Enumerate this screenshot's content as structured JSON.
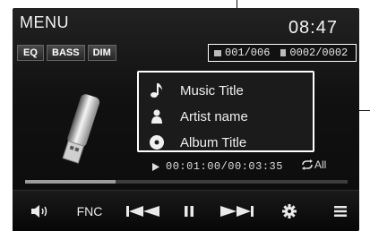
{
  "header": {
    "menu_label": "MENU",
    "clock": "08:47"
  },
  "toolbar": {
    "buttons": [
      "EQ",
      "BASS",
      "DIM"
    ]
  },
  "counter": {
    "folder": "001/006",
    "track": "0002/0002"
  },
  "track_info": {
    "title": "Music Title",
    "artist": "Artist name",
    "album": "Album Title",
    "icons": [
      "music-note-icon",
      "person-icon",
      "disc-icon"
    ]
  },
  "playback": {
    "time": "00:01:00/00:03:35",
    "repeat_label": "All",
    "progress_fraction": 0.28
  },
  "controls": {
    "fnc_label": "FNC"
  }
}
